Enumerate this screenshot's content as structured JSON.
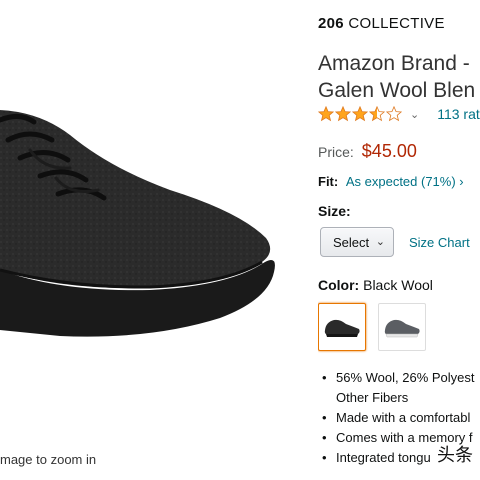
{
  "image_pane": {
    "zoom_hint": "mage to zoom in"
  },
  "product": {
    "brand_bold": "206",
    "brand_rest": "COLLECTIVE",
    "title_line1": "Amazon Brand -",
    "title_line2": "Galen Wool Blen",
    "rating": {
      "stars_value": 3.5,
      "stars_max": 5,
      "dropdown_glyph": "⌄",
      "ratings_link": "113 rat"
    },
    "price": {
      "label": "Price:",
      "value": "$45.00"
    },
    "fit": {
      "label": "Fit:",
      "link": "As expected (71%) ›"
    },
    "size": {
      "label": "Size:",
      "select_value": "Select",
      "size_chart_link": "Size Chart"
    },
    "color": {
      "label": "Color:",
      "value": "Black Wool",
      "swatches": [
        {
          "name": "Black Wool",
          "selected": true
        },
        {
          "name": "Grey Wool",
          "selected": false
        }
      ]
    },
    "features": [
      {
        "line1": "56% Wool, 26% Polyest",
        "line2": "Other Fibers"
      },
      {
        "line1": "Made with a comfortabl",
        "line2": ""
      },
      {
        "line1": "Comes with a memory f",
        "line2": ""
      },
      {
        "line1": "Integrated tongu",
        "line2": ""
      }
    ]
  },
  "watermark": "头条",
  "colors": {
    "link": "#007185",
    "price": "#B12704",
    "star": "#FFA41C",
    "selected_border": "#E77600"
  },
  "icons": {
    "star_full": "star-icon",
    "star_half": "half-star-icon",
    "star_empty": "empty-star-icon",
    "dropdown": "chevron-down-icon"
  }
}
